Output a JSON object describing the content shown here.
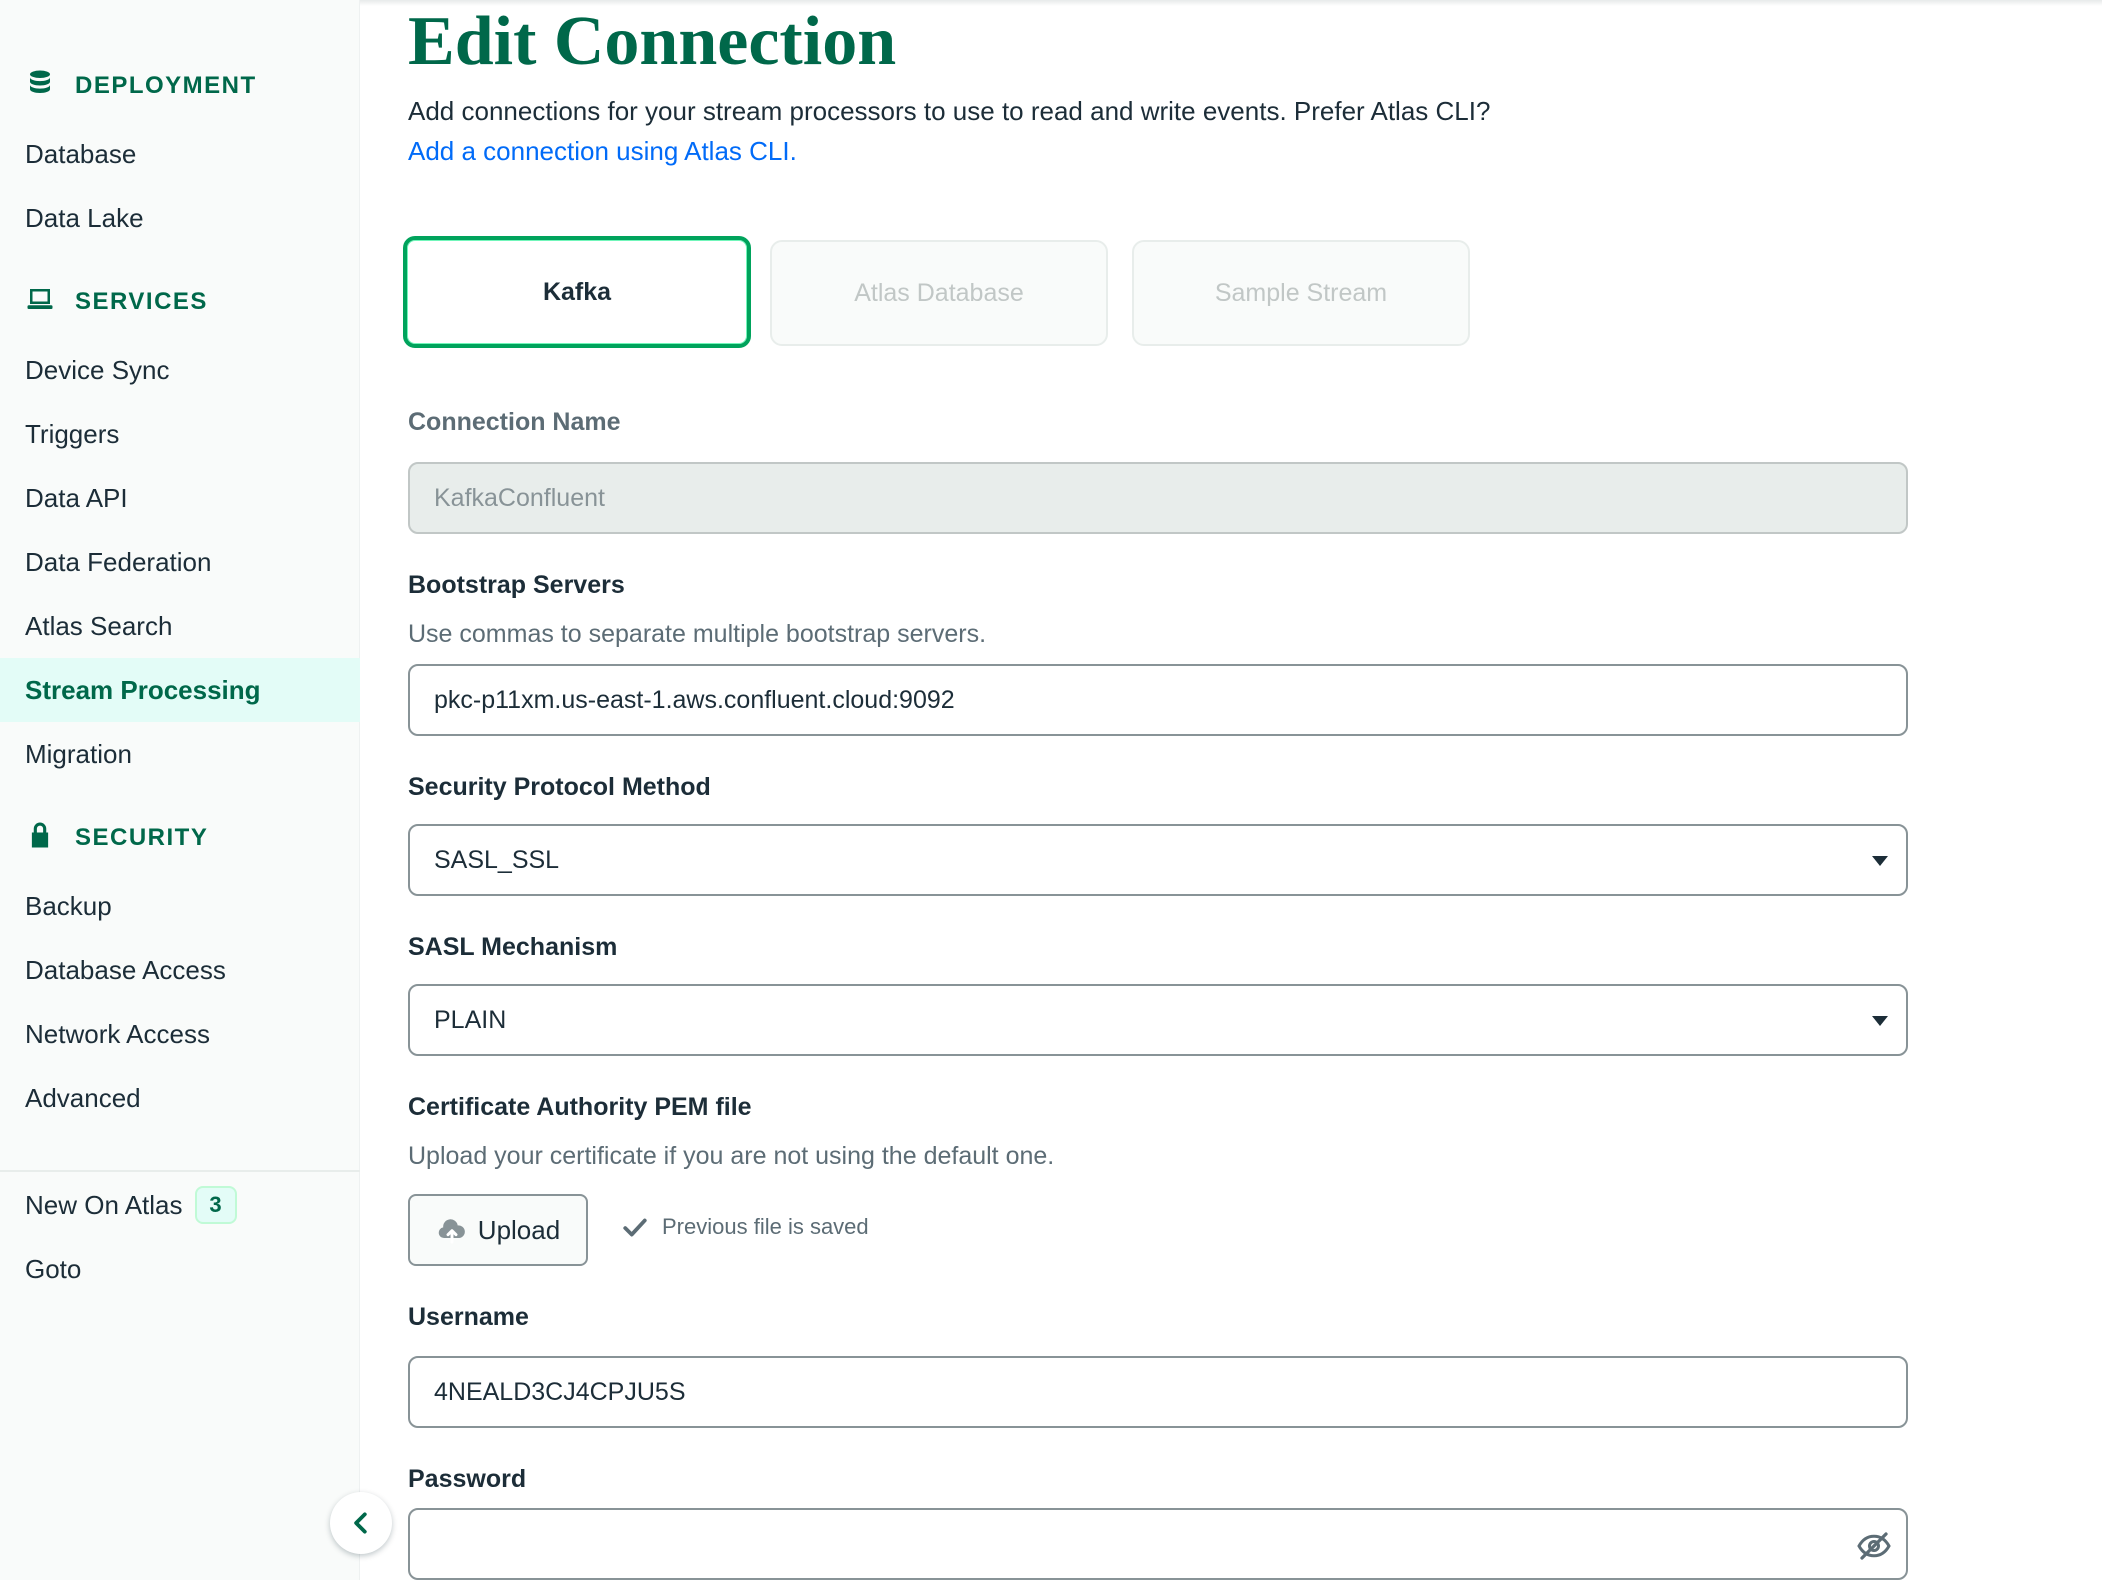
{
  "sidebar": {
    "deployment": {
      "heading": "DEPLOYMENT",
      "icon": "database-stack-icon",
      "items": [
        {
          "label": "Database"
        },
        {
          "label": "Data Lake"
        }
      ]
    },
    "services": {
      "heading": "SERVICES",
      "icon": "laptop-icon",
      "items": [
        {
          "label": "Device Sync"
        },
        {
          "label": "Triggers"
        },
        {
          "label": "Data API"
        },
        {
          "label": "Data Federation"
        },
        {
          "label": "Atlas Search"
        },
        {
          "label": "Stream Processing",
          "active": true
        },
        {
          "label": "Migration"
        }
      ]
    },
    "security": {
      "heading": "SECURITY",
      "icon": "lock-icon",
      "items": [
        {
          "label": "Backup"
        },
        {
          "label": "Database Access"
        },
        {
          "label": "Network Access"
        },
        {
          "label": "Advanced"
        }
      ]
    },
    "footer": {
      "new_on_atlas": "New On Atlas",
      "new_on_atlas_count": "3",
      "goto": "Goto"
    }
  },
  "main": {
    "title": "Edit Connection",
    "description": "Add connections for your stream processors to use to read and write events. Prefer Atlas CLI?",
    "cli_link": "Add a connection using Atlas CLI.",
    "connection_types": [
      {
        "label": "Kafka",
        "selected": true
      },
      {
        "label": "Atlas Database",
        "disabled": true
      },
      {
        "label": "Sample Stream",
        "disabled": true
      }
    ],
    "fields": {
      "connection_name": {
        "label": "Connection Name",
        "value": "KafkaConfluent"
      },
      "bootstrap_servers": {
        "label": "Bootstrap Servers",
        "help": "Use commas to separate multiple bootstrap servers.",
        "value": "pkc-p11xm.us-east-1.aws.confluent.cloud:9092"
      },
      "security_protocol": {
        "label": "Security Protocol Method",
        "value": "SASL_SSL"
      },
      "sasl_mechanism": {
        "label": "SASL Mechanism",
        "value": "PLAIN"
      },
      "ca_pem": {
        "label": "Certificate Authority PEM file",
        "help": "Upload your certificate if you are not using the default one.",
        "upload_label": "Upload",
        "saved_text": "Previous file is saved"
      },
      "username": {
        "label": "Username",
        "value": "4NEALD3CJ4CPJU5S"
      },
      "password": {
        "label": "Password",
        "value": ""
      }
    }
  },
  "colors": {
    "brand_green": "#00684a",
    "selected_border": "#00a35c",
    "link_blue": "#016bf8"
  }
}
